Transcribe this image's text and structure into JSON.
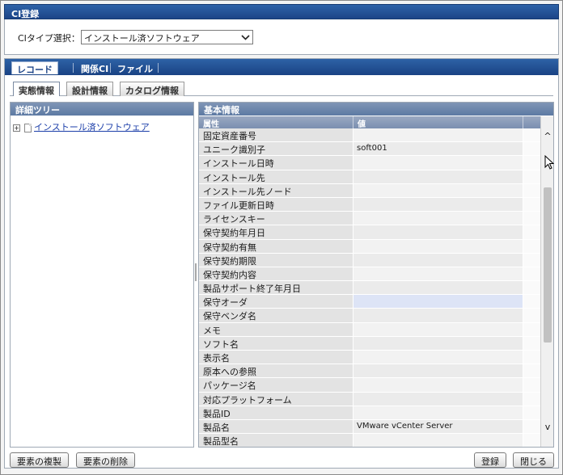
{
  "window": {
    "title": "CI登録"
  },
  "ci_type": {
    "label": "CIタイプ選択：",
    "value": "インストール済ソフトウェア"
  },
  "main_tabs": [
    {
      "label": "レコード",
      "active": true
    },
    {
      "label": "関係CI",
      "active": false
    },
    {
      "label": "ファイル",
      "active": false
    }
  ],
  "sub_tabs": [
    {
      "label": "実態情報",
      "active": true
    },
    {
      "label": "設計情報",
      "active": false
    },
    {
      "label": "カタログ情報",
      "active": false
    }
  ],
  "tree": {
    "header": "詳細ツリー",
    "toggle": "+",
    "node_label": "インストール済ソフトウェア"
  },
  "detail": {
    "header": "基本情報",
    "columns": {
      "attribute": "属性",
      "value": "値"
    },
    "rows": [
      {
        "k": "固定資産番号",
        "v": ""
      },
      {
        "k": "ユニーク識別子",
        "v": "soft001"
      },
      {
        "k": "インストール日時",
        "v": ""
      },
      {
        "k": "インストール先",
        "v": ""
      },
      {
        "k": "インストール先ノード",
        "v": ""
      },
      {
        "k": "ファイル更新日時",
        "v": ""
      },
      {
        "k": "ライセンスキー",
        "v": ""
      },
      {
        "k": "保守契約年月日",
        "v": ""
      },
      {
        "k": "保守契約有無",
        "v": ""
      },
      {
        "k": "保守契約期限",
        "v": ""
      },
      {
        "k": "保守契約内容",
        "v": ""
      },
      {
        "k": "製品サポート終了年月日",
        "v": ""
      },
      {
        "k": "保守オーダ",
        "v": ""
      },
      {
        "k": "保守ベンダ名",
        "v": ""
      },
      {
        "k": "メモ",
        "v": ""
      },
      {
        "k": "ソフト名",
        "v": ""
      },
      {
        "k": "表示名",
        "v": ""
      },
      {
        "k": "原本への参照",
        "v": ""
      },
      {
        "k": "パッケージ名",
        "v": ""
      },
      {
        "k": "対応プラットフォーム",
        "v": ""
      },
      {
        "k": "製品ID",
        "v": ""
      },
      {
        "k": "製品名",
        "v": "VMware vCenter Server"
      },
      {
        "k": "製品型名",
        "v": ""
      }
    ],
    "selected_row_index": 12,
    "scroll_up_glyph": "^",
    "scroll_down_glyph": "v"
  },
  "buttons": {
    "duplicate": "要素の複製",
    "delete": "要素の削除",
    "register": "登録",
    "close": "閉じる"
  }
}
